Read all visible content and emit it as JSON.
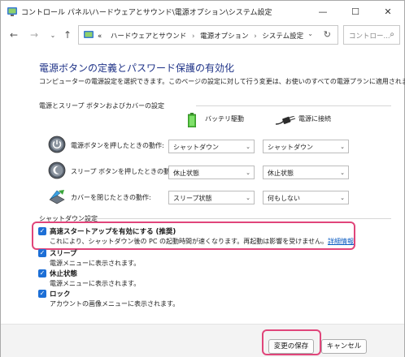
{
  "window": {
    "title": "コントロール パネル\\ハードウェアとサウンド\\電源オプション\\システム設定",
    "minimize": "—",
    "maximize": "☐",
    "close": "✕"
  },
  "nav": {
    "back": "←",
    "forward": "→",
    "recent": "⌄",
    "up": "↑",
    "overflow": "«",
    "breadcrumbs": [
      "ハードウェアとサウンド",
      "電源オプション",
      "システム設定"
    ],
    "separator": "›",
    "dropdown": "⌄",
    "refresh": "↻",
    "search_placeholder": "コントロー...",
    "search_icon": "⌕"
  },
  "page": {
    "title": "電源ボタンの定義とパスワード保護の有効化",
    "description": "コンピューターの電源設定を選択できます。このページの設定に対して行う変更は、お使いのすべての電源プランに適用されます。",
    "section_buttons": "電源とスリープ ボタンおよびカバーの設定",
    "col_battery": "バッテリ駆動",
    "col_ac": "電源に接続",
    "rows": [
      {
        "label": "電源ボタンを押したときの動作:",
        "battery": "シャットダウン",
        "ac": "シャットダウン",
        "icon": "power-icon"
      },
      {
        "label": "スリープ ボタンを押したときの動作:",
        "battery": "休止状態",
        "ac": "休止状態",
        "icon": "sleep-icon"
      },
      {
        "label": "カバーを閉じたときの動作:",
        "battery": "スリープ状態",
        "ac": "何もしない",
        "icon": "laptop-lid-icon"
      }
    ],
    "section_shutdown": "シャットダウン設定",
    "shutdown_options": [
      {
        "label": "高速スタートアップを有効にする (推奨)",
        "desc": "これにより、シャットダウン後の PC の起動時間が速くなります。再起動は影響を受けません。",
        "link": "詳細情報",
        "checked": true
      },
      {
        "label": "スリープ",
        "desc": "電源メニューに表示されます。",
        "checked": true
      },
      {
        "label": "休止状態",
        "desc": "電源メニューに表示されます。",
        "checked": true
      },
      {
        "label": "ロック",
        "desc": "アカウントの画像メニューに表示されます。",
        "checked": true
      }
    ]
  },
  "footer": {
    "save": "変更の保存",
    "cancel": "キャンセル"
  },
  "colors": {
    "title": "#1e3287",
    "checkbox": "#1d6fd6",
    "highlight": "#e0457a",
    "link": "#0b5cc2"
  }
}
